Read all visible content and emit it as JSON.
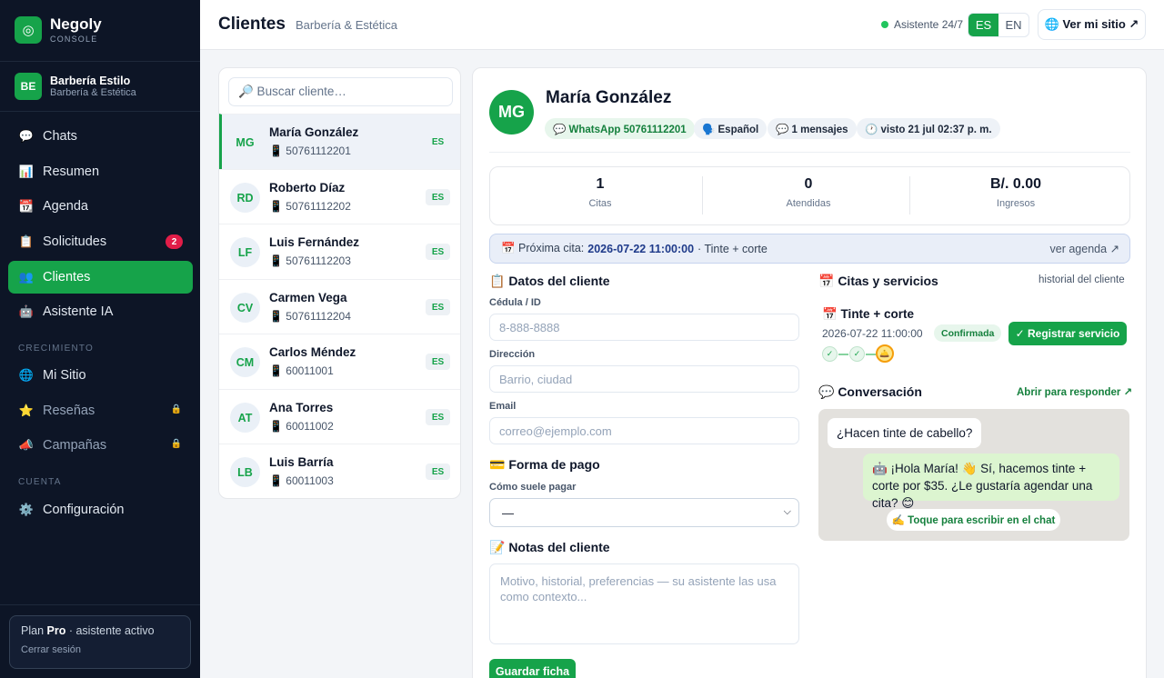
{
  "brand": {
    "name": "Negoly",
    "sub": "CONSOLE",
    "logo_icon": "target-icon"
  },
  "business": {
    "initials": "BE",
    "name": "Barbería Estilo",
    "category": "Barbería & Estética"
  },
  "nav": {
    "items": [
      {
        "icon": "💬",
        "label": "Chats"
      },
      {
        "icon": "📊",
        "label": "Resumen"
      },
      {
        "icon": "📆",
        "label": "Agenda"
      },
      {
        "icon": "📋",
        "label": "Solicitudes",
        "badge": "2"
      },
      {
        "icon": "👥",
        "label": "Clientes",
        "active": true
      },
      {
        "icon": "🤖",
        "label": "Asistente IA"
      }
    ],
    "section_growth": "CRECIMIENTO",
    "growth": [
      {
        "icon": "🌐",
        "label": "Mi Sitio"
      },
      {
        "icon": "⭐",
        "label": "Reseñas",
        "locked": true
      },
      {
        "icon": "📣",
        "label": "Campañas",
        "locked": true
      }
    ],
    "section_account": "CUENTA",
    "account": [
      {
        "icon": "⚙️",
        "label": "Configuración"
      }
    ]
  },
  "plan": {
    "prefix": "Plan",
    "name": "Pro",
    "suffix": "· asistente activo",
    "logout": "Cerrar sesión"
  },
  "header": {
    "title": "Clientes",
    "subtitle": "Barbería & Estética",
    "assistant_status": "Asistente 24/7",
    "lang_es": "ES",
    "lang_en": "EN",
    "site_button": "🌐 Ver mi sitio ↗"
  },
  "search": {
    "placeholder": "🔎 Buscar cliente…"
  },
  "clients": [
    {
      "initials": "MG",
      "name": "María González",
      "phone": "📱 50761112201",
      "lang": "ES",
      "selected": true
    },
    {
      "initials": "RD",
      "name": "Roberto Díaz",
      "phone": "📱 50761112202",
      "lang": "ES"
    },
    {
      "initials": "LF",
      "name": "Luis Fernández",
      "phone": "📱 50761112203",
      "lang": "ES"
    },
    {
      "initials": "CV",
      "name": "Carmen Vega",
      "phone": "📱 50761112204",
      "lang": "ES"
    },
    {
      "initials": "CM",
      "name": "Carlos Méndez",
      "phone": "📱 60011001",
      "lang": "ES"
    },
    {
      "initials": "AT",
      "name": "Ana Torres",
      "phone": "📱 60011002",
      "lang": "ES"
    },
    {
      "initials": "LB",
      "name": "Luis Barría",
      "phone": "📱 60011003",
      "lang": "ES"
    }
  ],
  "detail": {
    "initials": "MG",
    "name": "María González",
    "chips": {
      "whatsapp": "💬 WhatsApp 50761112201",
      "language": "🗣️ Español",
      "messages": "💬 1 mensajes",
      "seen": "🕐 visto 21 jul 02:37 p. m."
    },
    "stats": [
      {
        "value": "1",
        "label": "Citas"
      },
      {
        "value": "0",
        "label": "Atendidas"
      },
      {
        "value": "B/. 0.00",
        "label": "Ingresos"
      }
    ],
    "next": {
      "prefix": "📅 Próxima cita:",
      "datetime": "2026-07-22 11:00:00",
      "service": "· Tinte + corte",
      "link": "ver agenda ↗"
    },
    "client_data": {
      "title": "📋 Datos del cliente",
      "id_label": "Cédula / ID",
      "id_placeholder": "8-888-8888",
      "address_label": "Dirección",
      "address_placeholder": "Barrio, ciudad",
      "email_label": "Email",
      "email_placeholder": "correo@ejemplo.com"
    },
    "payment": {
      "title": "💳 Forma de pago",
      "label": "Cómo suele pagar",
      "selected": "—"
    },
    "notes": {
      "title": "📝 Notas del cliente",
      "placeholder": "Motivo, historial, preferencias — su asistente las usa como contexto..."
    },
    "save_button": "Guardar ficha",
    "appointments": {
      "title": "📅 Citas y servicios",
      "history_link": "historial del cliente",
      "service": "📅 Tinte + corte",
      "date": "2026-07-22 11:00:00",
      "status": "Confirmada",
      "register_button": "✓ Registrar servicio",
      "steps": [
        "✓",
        "✓",
        "🛎️"
      ]
    },
    "conversation": {
      "title": "💬 Conversación",
      "open_link": "Abrir para responder ↗",
      "incoming": "¿Hacen tinte de cabello?",
      "outgoing": "🤖 ¡Hola María! 👋 Sí, hacemos tinte + corte por $35. ¿Le gustaría agendar una cita? 😊",
      "tap_hint": "✍️ Toque para escribir en el chat"
    }
  },
  "colors": {
    "accent": "#16a34a",
    "sidebar": "#0d1526",
    "badge": "#e11d48"
  }
}
